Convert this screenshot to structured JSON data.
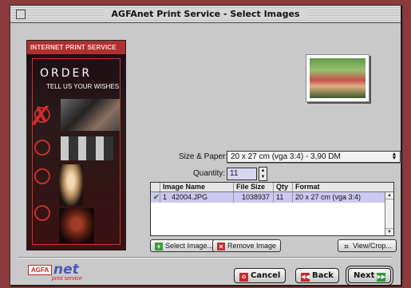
{
  "window": {
    "title": "AGFAnet Print Service - Select Images"
  },
  "banner": {
    "header": "INTERNET PRINT SERVICE",
    "headline": "ORDER",
    "tagline": "TELL US YOUR WISHES"
  },
  "form": {
    "size_paper_label": "Size & Paper:",
    "size_paper_value": "20 x 27 cm (vga 3:4) - 3,90 DM",
    "quantity_label": "Quantity:",
    "quantity_value": "11"
  },
  "table": {
    "columns": [
      "",
      "Image Name",
      "File Size",
      "Qty",
      "Format"
    ],
    "rows": [
      {
        "checked": "✔",
        "num": "1",
        "name": "42004.JPG",
        "size": "1038937",
        "qty": "11",
        "format": "20 x 27 cm (vga 3:4)"
      }
    ]
  },
  "buttons": {
    "select_image": "Select Image...",
    "remove_image": "Remove Image",
    "view_crop": "View/Crop...",
    "cancel": "Cancel",
    "back": "Back",
    "next": "Next"
  },
  "logo": {
    "agfa": "AGFA",
    "net": "net",
    "sub": "print service"
  }
}
